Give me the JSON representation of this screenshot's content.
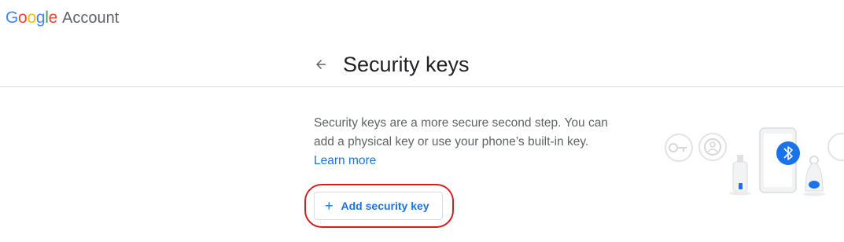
{
  "brand": {
    "logo_letters": [
      "G",
      "o",
      "o",
      "g",
      "l",
      "e"
    ],
    "product": "Account"
  },
  "header": {
    "back_icon": "arrow-back-icon",
    "title": "Security keys"
  },
  "main": {
    "description": "Security keys are a more secure second step. You can add a physical key or use your phone’s built-in key.",
    "learn_more": "Learn more",
    "add_button": {
      "icon": "plus-icon",
      "plus_glyph": "+",
      "label": "Add security key"
    }
  },
  "illustration": {
    "icons": [
      "key-icon",
      "person-icon",
      "phone-icon",
      "bluetooth-icon",
      "usb-key-icon",
      "fob-key-icon"
    ]
  },
  "colors": {
    "accent": "#1a73e8",
    "highlight": "#d41e1e",
    "text_secondary": "#5f6368",
    "divider": "#dadce0"
  }
}
